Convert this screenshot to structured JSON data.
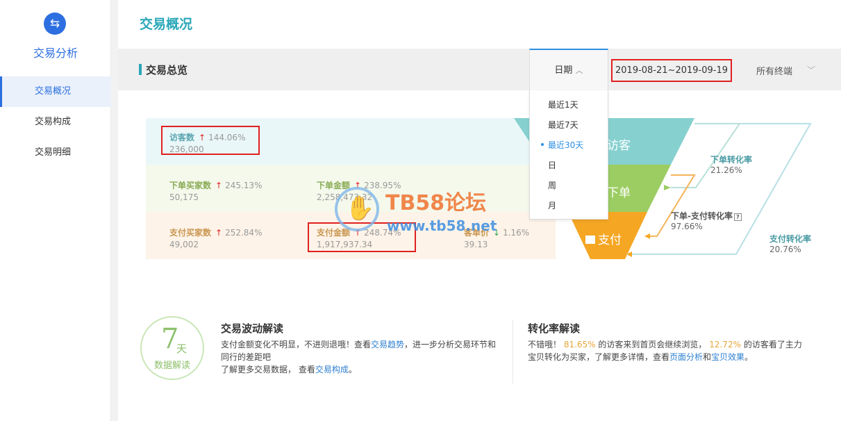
{
  "sidebar": {
    "icon": "exchange-icon",
    "title": "交易分析",
    "items": [
      {
        "label": "交易概况",
        "active": true
      },
      {
        "label": "交易构成",
        "active": false
      },
      {
        "label": "交易明细",
        "active": false
      }
    ]
  },
  "page": {
    "title": "交易概况"
  },
  "section": {
    "title": "交易总览"
  },
  "date_dropdown": {
    "label": "日期",
    "options": [
      "最近1天",
      "最近7天",
      "最近30天",
      "日",
      "周",
      "月"
    ],
    "selected": "最近30天"
  },
  "date_range": "2019-08-21~2019-09-19",
  "terminal_select": "所有终端",
  "metrics": {
    "visitors": {
      "label": "访客数",
      "pct": "144.06%",
      "value": "236,000"
    },
    "order_buyers": {
      "label": "下单买家数",
      "pct": "245.13%",
      "value": "50,175"
    },
    "order_amount": {
      "label": "下单金额",
      "pct": "238.95%",
      "value": "2,258,473.32"
    },
    "pay_buyers": {
      "label": "支付买家数",
      "pct": "252.84%",
      "value": "49,002"
    },
    "pay_amount": {
      "label": "支付金额",
      "pct": "248.74%",
      "value": "1,917,937.34"
    },
    "unit_price": {
      "label": "客单价",
      "pct": "1.16%",
      "value": "39.13"
    }
  },
  "funnel": {
    "visitor": "访客",
    "order": "下单",
    "pay": "支付"
  },
  "conversions": {
    "order_rate": {
      "label": "下单转化率",
      "value": "21.26%"
    },
    "order_pay_rate": {
      "label": "下单-支付转化率",
      "value": "97.66%"
    },
    "pay_rate": {
      "label": "支付转化率",
      "value": "20.76%"
    }
  },
  "watermark": {
    "text": "TB58论坛",
    "url": "www.tb58.net"
  },
  "badge": {
    "num": "7",
    "unit": "天",
    "text": "数据解读"
  },
  "fluctuation": {
    "title": "交易波动解读",
    "line1_a": "支付金额变化不明显，不进则退哦！查看",
    "line1_link": "交易趋势",
    "line1_b": "，进一步分析交易环节和",
    "line2": "同行的差距吧",
    "line3_a": "了解更多交易数据，  查看",
    "line3_link": "交易构成",
    "line3_b": "。"
  },
  "conversion_read": {
    "title": "转化率解读",
    "a": "不错哦！ ",
    "pct1": "81.65%",
    "b": " 的访客来到首页会继续浏览，  ",
    "pct2": "12.72%",
    "c": " 的访客看了主力",
    "line2_a": "宝贝转化为买家，了解更多详情，查看",
    "link1": "页面分析",
    "and": "和",
    "link2": "宝贝效果",
    "end": "。"
  },
  "colors": {
    "accent": "#2aa7b8",
    "visitor": "#86d0d0",
    "order": "#9ccd62",
    "pay": "#f5a623"
  }
}
